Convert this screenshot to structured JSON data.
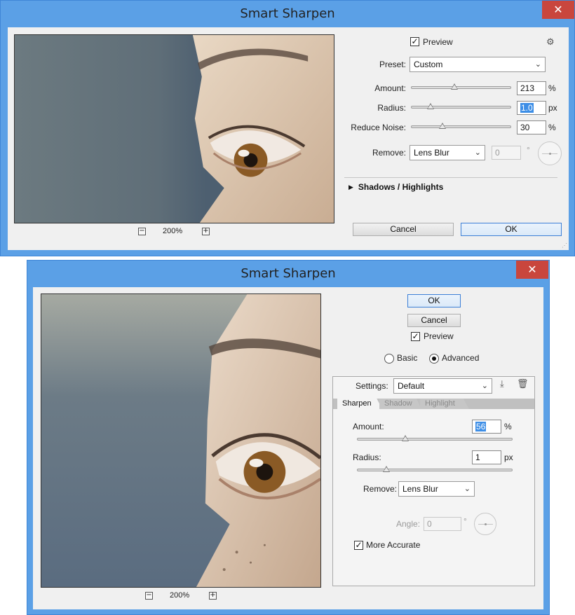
{
  "dialog_basic": {
    "title": "Smart Sharpen",
    "close_glyph": "✕",
    "preview_checked": true,
    "preview_label": "Preview",
    "settings_icon": "gear-icon",
    "settings_glyph": "⚙",
    "preset_label": "Preset:",
    "preset_value": "Custom",
    "amount_label": "Amount:",
    "amount_value": "213",
    "amount_unit": "%",
    "amount_slider_fraction": 0.43,
    "radius_label": "Radius:",
    "radius_value": "1.0",
    "radius_unit": "px",
    "radius_slider_fraction": 0.17,
    "noise_label": "Reduce Noise:",
    "noise_value": "30",
    "noise_unit": "%",
    "noise_slider_fraction": 0.3,
    "remove_label": "Remove:",
    "remove_value": "Lens Blur",
    "angle_value": "0",
    "angle_unit": "°",
    "shadows_label": "Shadows / Highlights",
    "zoom_out_glyph": "−",
    "zoom_level": "200%",
    "zoom_in_glyph": "+",
    "cancel_label": "Cancel",
    "ok_label": "OK"
  },
  "dialog_advanced": {
    "title": "Smart Sharpen",
    "close_glyph": "✕",
    "ok_label": "OK",
    "cancel_label": "Cancel",
    "preview_checked": true,
    "preview_label": "Preview",
    "mode_basic_label": "Basic",
    "mode_advanced_label": "Advanced",
    "mode_selected": "Advanced",
    "settings_label": "Settings:",
    "settings_value": "Default",
    "save_icon": "save-preset-icon",
    "delete_icon": "trash-icon",
    "tabs": [
      "Sharpen",
      "Shadow",
      "Highlight"
    ],
    "active_tab": "Sharpen",
    "amount_label": "Amount:",
    "amount_value": "56",
    "amount_unit": "%",
    "amount_slider_fraction": 0.3,
    "radius_label": "Radius:",
    "radius_value": "1",
    "radius_unit": "px",
    "radius_slider_fraction": 0.17,
    "remove_label": "Remove:",
    "remove_value": "Lens Blur",
    "angle_label": "Angle:",
    "angle_value": "0",
    "angle_unit": "°",
    "more_accurate_checked": true,
    "more_accurate_label": "More Accurate",
    "zoom_out_glyph": "−",
    "zoom_level": "200%",
    "zoom_in_glyph": "+"
  },
  "colors": {
    "title_bar": "#5ba0e6",
    "close_button": "#c9463d",
    "dialog_face": "#f0f0f0",
    "selection_highlight": "#3d8ee6"
  }
}
